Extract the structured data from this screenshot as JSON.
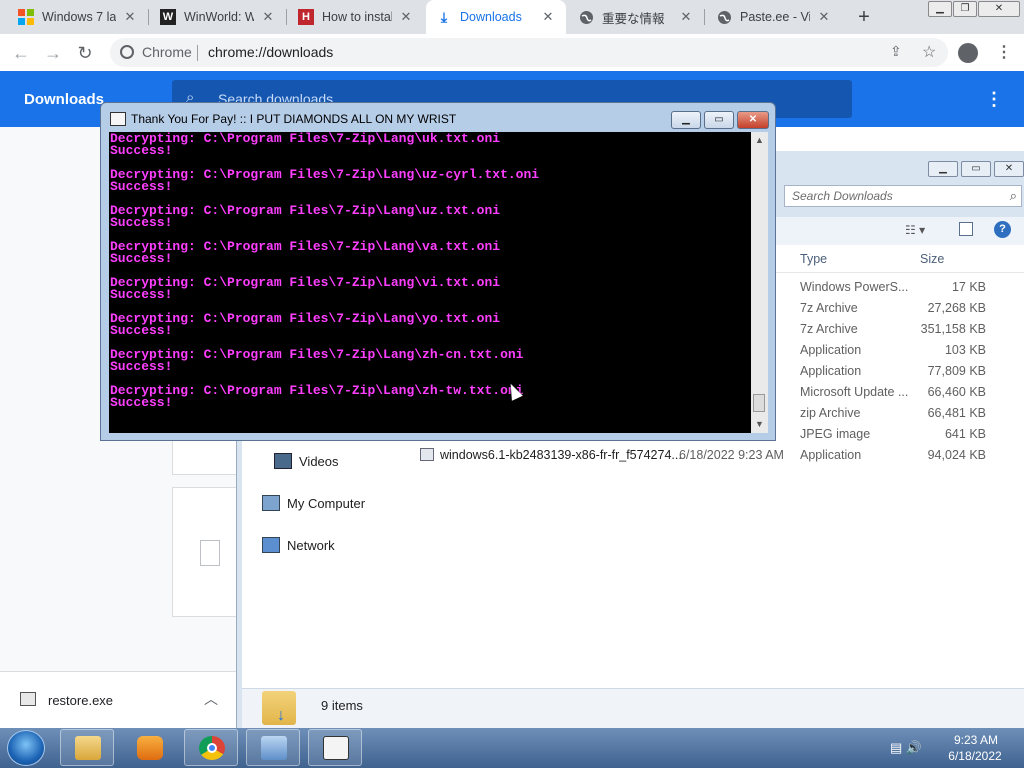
{
  "browser": {
    "tabs": [
      {
        "title": "Windows 7 lar",
        "favicon": "windows-logo-icon",
        "active": false
      },
      {
        "title": "WinWorld: W",
        "favicon": "winworld-w-icon",
        "active": false
      },
      {
        "title": "How to instal",
        "favicon": "howto-h-icon",
        "active": false
      },
      {
        "title": "Downloads",
        "favicon": "download-arrow-icon",
        "active": true
      },
      {
        "title": "重要な情報",
        "favicon": "globe-icon",
        "active": false
      },
      {
        "title": "Paste.ee - Vie",
        "favicon": "globe-icon",
        "active": false
      }
    ],
    "new_tab": "+",
    "omnibox": {
      "site_label": "Chrome",
      "url": "chrome://downloads"
    }
  },
  "downloads_page": {
    "title": "Downloads",
    "search_placeholder": "Search downloads",
    "shelf_file": "restore.exe"
  },
  "explorer": {
    "search_placeholder": "Search Downloads",
    "columns": {
      "type": "Type",
      "size": "Size"
    },
    "nav": [
      "Videos",
      "My Computer",
      "Network"
    ],
    "rows": [
      {
        "type": "Windows PowerS...",
        "size": "17 KB"
      },
      {
        "type": "7z Archive",
        "size": "27,268 KB"
      },
      {
        "type": "7z Archive",
        "size": "351,158 KB"
      },
      {
        "type": "Application",
        "size": "103 KB"
      },
      {
        "type": "Application",
        "size": "77,809 KB"
      },
      {
        "type": "Microsoft Update ...",
        "size": "66,460 KB"
      },
      {
        "type": "zip Archive",
        "size": "66,481 KB"
      },
      {
        "type": "JPEG image",
        "size": "641 KB"
      },
      {
        "name": "windows6.1-kb2483139-x86-fr-fr_f574274...",
        "date": "6/18/2022 9:23 AM",
        "type": "Application",
        "size": "94,024 KB"
      }
    ],
    "status": "9 items"
  },
  "console": {
    "title": "Thank You For Pay! :: I PUT DIAMONDS ALL ON MY WRIST",
    "text_color": "#ff3fff",
    "lines": [
      "Decrypting: C:\\Program Files\\7-Zip\\Lang\\uk.txt.oni",
      "Success!",
      "",
      "Decrypting: C:\\Program Files\\7-Zip\\Lang\\uz-cyrl.txt.oni",
      "Success!",
      "",
      "Decrypting: C:\\Program Files\\7-Zip\\Lang\\uz.txt.oni",
      "Success!",
      "",
      "Decrypting: C:\\Program Files\\7-Zip\\Lang\\va.txt.oni",
      "Success!",
      "",
      "Decrypting: C:\\Program Files\\7-Zip\\Lang\\vi.txt.oni",
      "Success!",
      "",
      "Decrypting: C:\\Program Files\\7-Zip\\Lang\\yo.txt.oni",
      "Success!",
      "",
      "Decrypting: C:\\Program Files\\7-Zip\\Lang\\zh-cn.txt.oni",
      "Success!",
      "",
      "Decrypting: C:\\Program Files\\7-Zip\\Lang\\zh-tw.txt.oni",
      "Success!"
    ]
  },
  "taskbar": {
    "clock_time": "9:23 AM",
    "clock_date": "6/18/2022"
  },
  "colors": {
    "chrome_accent": "#1a73e8",
    "console_bg": "#000000"
  }
}
